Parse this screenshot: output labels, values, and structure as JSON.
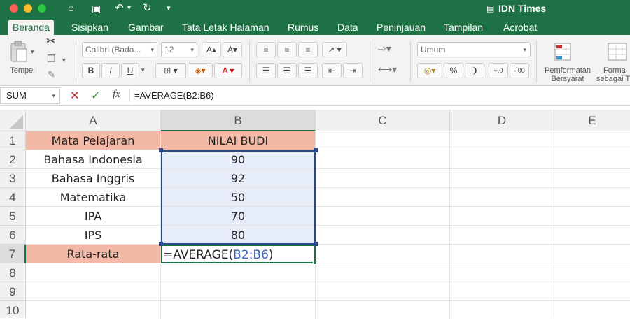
{
  "window": {
    "title": "IDN Times"
  },
  "ribbon_tabs": [
    "Beranda",
    "Sisipkan",
    "Gambar",
    "Tata Letak Halaman",
    "Rumus",
    "Data",
    "Peninjauan",
    "Tampilan",
    "Acrobat"
  ],
  "ribbon": {
    "paste_label": "Tempel",
    "font_name": "Calibri (Bada...",
    "font_size": "12",
    "number_format": "Umum",
    "bold": "B",
    "italic": "I",
    "underline": "U",
    "percent": "%",
    "cond_format_line1": "Pemformatan",
    "cond_format_line2": "Bersyarat",
    "format_table_line1": "Forma",
    "format_table_line2": "sebagai T"
  },
  "formula_bar": {
    "name_box": "SUM",
    "cancel": "✕",
    "enter": "✓",
    "fx": "fx",
    "formula": "=AVERAGE(B2:B6)"
  },
  "columns": [
    "A",
    "B",
    "C",
    "D",
    "E"
  ],
  "rows": [
    "1",
    "2",
    "3",
    "4",
    "5",
    "6",
    "7",
    "8",
    "9",
    "10"
  ],
  "cells": {
    "A1": "Mata Pelajaran",
    "B1": "NILAI BUDI",
    "A2": "Bahasa Indonesia",
    "B2": "90",
    "A3": "Bahasa Inggris",
    "B3": "92",
    "A4": "Matematika",
    "B4": "50",
    "A5": "IPA",
    "B5": "70",
    "A6": "IPS",
    "B6": "80",
    "A7": "Rata-rata",
    "B7_prefix": "=AVERAGE(",
    "B7_ref": "B2:B6",
    "B7_suffix": ")"
  },
  "colors": {
    "brand_green": "#1e7145",
    "header_fill": "#f4b9a6",
    "range_fill": "#e7ecf9",
    "range_border": "#2a4a8f",
    "ref_blue": "#3a64b6"
  }
}
